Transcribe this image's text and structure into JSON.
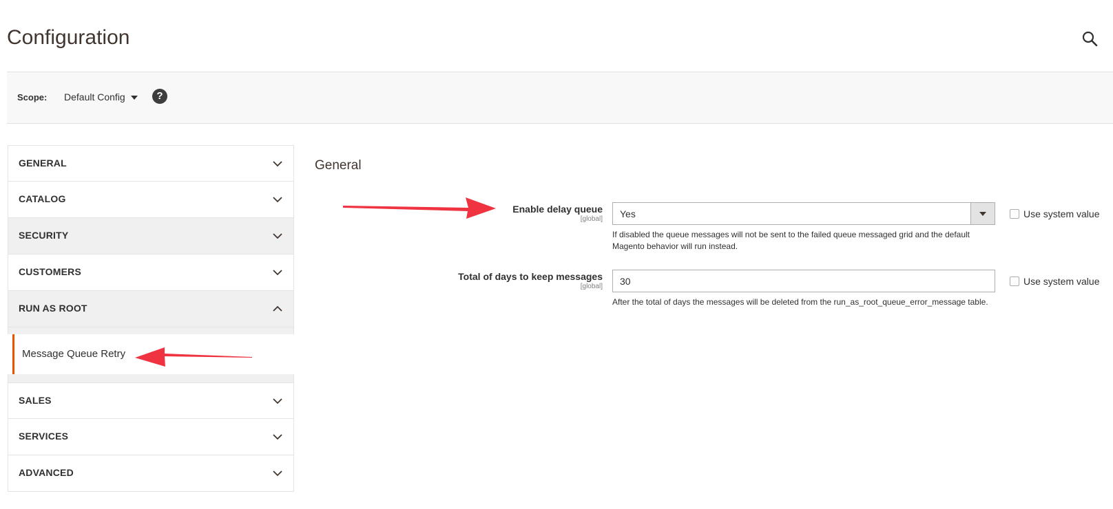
{
  "page": {
    "title": "Configuration"
  },
  "scope": {
    "label": "Scope:",
    "value": "Default Config",
    "help": "?"
  },
  "sidebar": {
    "items": [
      {
        "label": "GENERAL"
      },
      {
        "label": "CATALOG"
      },
      {
        "label": "SECURITY"
      },
      {
        "label": "CUSTOMERS"
      },
      {
        "label": "RUN AS ROOT"
      },
      {
        "label": "SALES"
      },
      {
        "label": "SERVICES"
      },
      {
        "label": "ADVANCED"
      }
    ],
    "sub_item": {
      "label": "Message Queue Retry"
    }
  },
  "main": {
    "section_title": "General",
    "fields": [
      {
        "label": "Enable delay queue",
        "scope": "[global]",
        "value": "Yes",
        "note": "If disabled the queue messages will not be sent to the failed queue messaged grid and the default Magento behavior will run instead.",
        "use_system_value": "Use system value"
      },
      {
        "label": "Total of days to keep messages",
        "scope": "[global]",
        "value": "30",
        "note": "After the total of days the messages will be deleted from the run_as_root_queue_error_message table.",
        "use_system_value": "Use system value"
      }
    ]
  },
  "colors": {
    "accent": "#eb5202",
    "annotation": "#ef3340"
  }
}
